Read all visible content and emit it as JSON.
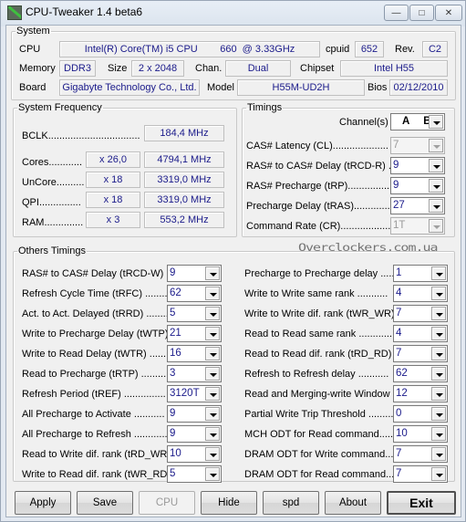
{
  "window": {
    "title": "CPU-Tweaker 1.4 beta6",
    "controls": {
      "minimize": "—",
      "maximize": "□",
      "close": "✕"
    }
  },
  "system": {
    "legend": "System",
    "cpu_label": "CPU",
    "cpu_value": "Intel(R) Core(TM) i5 CPU        660  @ 3.33GHz",
    "cpuid_label": "cpuid",
    "cpuid_value": "652",
    "rev_label": "Rev.",
    "rev_value": "C2",
    "memory_label": "Memory",
    "memory_value": "DDR3",
    "size_label": "Size",
    "size_value": "2 x 2048",
    "chan_label": "Chan.",
    "chan_value": "Dual",
    "chipset_label": "Chipset",
    "chipset_value": "Intel H55",
    "board_label": "Board",
    "board_value": "Gigabyte Technology Co., Ltd.",
    "model_label": "Model",
    "model_value": "H55M-UD2H",
    "bios_label": "Bios",
    "bios_value": "02/12/2010"
  },
  "frequency": {
    "legend": "System Frequency",
    "bclk_label": "BCLK.................................",
    "bclk_value": "184,4 MHz",
    "rows": [
      {
        "label": "Cores............",
        "mult": "x 26,0",
        "freq": "4794,1 MHz"
      },
      {
        "label": "UnCore..........",
        "mult": "x 18",
        "freq": "3319,0 MHz"
      },
      {
        "label": "QPI...............",
        "mult": "x 18",
        "freq": "3319,0 MHz"
      },
      {
        "label": "RAM..............",
        "mult": "x 3",
        "freq": "553,2 MHz"
      }
    ]
  },
  "timings": {
    "legend": "Timings",
    "channel_label": "Channel(s)",
    "channel_value": "A  B",
    "rows": [
      {
        "label": "CAS# Latency (CL)....................",
        "value": "7",
        "disabled": true
      },
      {
        "label": "RAS# to CAS# Delay (tRCD-R) ...",
        "value": "9",
        "disabled": false
      },
      {
        "label": "RAS# Precharge (tRP)................",
        "value": "9",
        "disabled": false
      },
      {
        "label": "Precharge Delay (tRAS).............",
        "value": "27",
        "disabled": false
      },
      {
        "label": "Command Rate (CR)...................",
        "value": "1T",
        "disabled": true
      }
    ]
  },
  "watermark": "Overclockers.com.ua",
  "others": {
    "legend": "Others Timings",
    "left": [
      {
        "label": "RAS# to CAS# Delay (tRCD-W) ..",
        "value": "9"
      },
      {
        "label": "Refresh Cycle Time (tRFC) .........",
        "value": "62"
      },
      {
        "label": "Act. to Act. Delayed (tRRD) ........",
        "value": "5"
      },
      {
        "label": "Write to Precharge Delay (tWTP)",
        "value": "21"
      },
      {
        "label": "Write to Read Delay (tWTR) ........",
        "value": "16"
      },
      {
        "label": "Read to Precharge (tRTP) ...........",
        "value": "3"
      },
      {
        "label": "Refresh Period (tREF) ...............",
        "value": "3120T"
      },
      {
        "label": "All Precharge to Activate ...........",
        "value": "9"
      },
      {
        "label": "All Precharge to Refresh ............",
        "value": "9"
      },
      {
        "label": "Read to Write dif. rank (tRD_WR)",
        "value": "10"
      },
      {
        "label": "Write to Read dif. rank (tWR_RD)",
        "value": "5"
      }
    ],
    "right": [
      {
        "label": "Precharge to Precharge delay .....",
        "value": "1"
      },
      {
        "label": "Write to Write same rank ...........",
        "value": "4"
      },
      {
        "label": "Write to Write dif. rank (tWR_WR)",
        "value": "7"
      },
      {
        "label": "Read to Read same rank ............",
        "value": "4"
      },
      {
        "label": "Read to Read dif. rank (tRD_RD) .",
        "value": "7"
      },
      {
        "label": "Refresh to Refresh delay ...........",
        "value": "62"
      },
      {
        "label": "Read and Merging-write Window",
        "value": "12"
      },
      {
        "label": "Partial Write Trip Threshold .........",
        "value": "0"
      },
      {
        "label": "MCH ODT for Read command.......",
        "value": "10"
      },
      {
        "label": "DRAM ODT for Write command....",
        "value": "7"
      },
      {
        "label": "DRAM ODT for Read command....",
        "value": "7"
      }
    ]
  },
  "buttons": {
    "apply": "Apply",
    "save": "Save",
    "cpu": "CPU",
    "hide": "Hide",
    "spd": "spd",
    "about": "About",
    "exit": "Exit"
  }
}
